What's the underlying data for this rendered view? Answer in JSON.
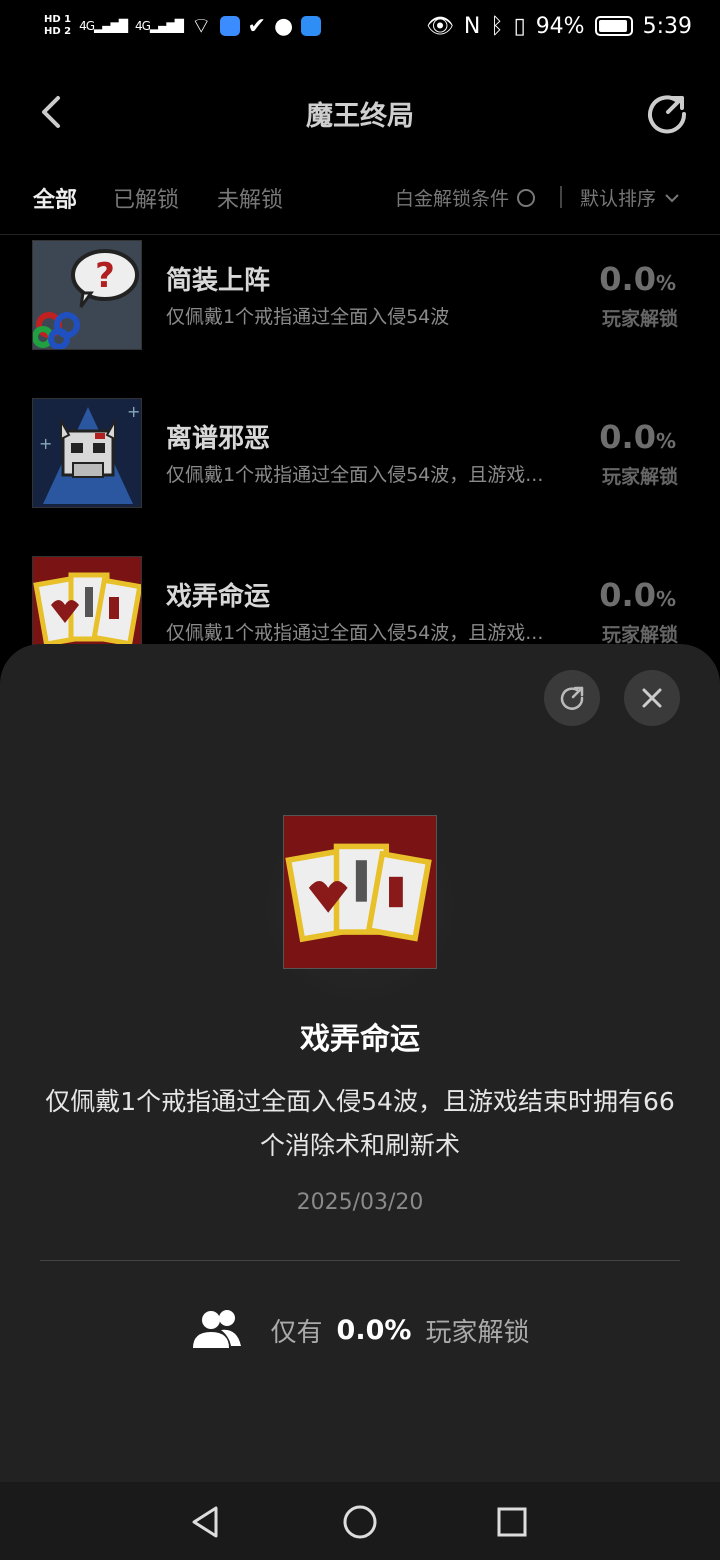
{
  "status_bar": {
    "hd1": "HD 1",
    "hd2": "HD 2",
    "net1": "4G",
    "net2": "4G",
    "battery": "94%",
    "time": "5:39",
    "battery_level": 0.94
  },
  "header": {
    "title": "魔王终局"
  },
  "tabs": {
    "all": "全部",
    "unlocked": "已解锁",
    "locked": "未解锁",
    "platinum": "白金解锁条件",
    "sort": "默认排序"
  },
  "items": [
    {
      "title": "简装上阵",
      "desc": "仅佩戴1个戒指通过全面入侵54波",
      "pct": "0.0",
      "pct_unit": "%",
      "sub": "玩家解锁",
      "icon": "speech-bubble-question-icon"
    },
    {
      "title": "离谱邪恶",
      "desc": "仅佩戴1个戒指通过全面入侵54波，且游戏...",
      "pct": "0.0",
      "pct_unit": "%",
      "sub": "玩家解锁",
      "icon": "horned-skull-icon"
    },
    {
      "title": "戏弄命运",
      "desc": "仅佩戴1个戒指通过全面入侵54波，且游戏...",
      "pct": "0.0",
      "pct_unit": "%",
      "sub": "玩家解锁",
      "icon": "playing-cards-icon"
    }
  ],
  "sheet": {
    "title": "戏弄命运",
    "desc": "仅佩戴1个戒指通过全面入侵54波，且游戏结束时拥有66个消除术和刷新术",
    "date": "2025/03/20",
    "unlock_prefix": "仅有",
    "unlock_pct": "0.0%",
    "unlock_suffix": "玩家解锁"
  },
  "colors": {
    "background": "#000000",
    "sheet": "#222222",
    "card_red": "#7a1414",
    "card_gold": "#e8c02a"
  }
}
